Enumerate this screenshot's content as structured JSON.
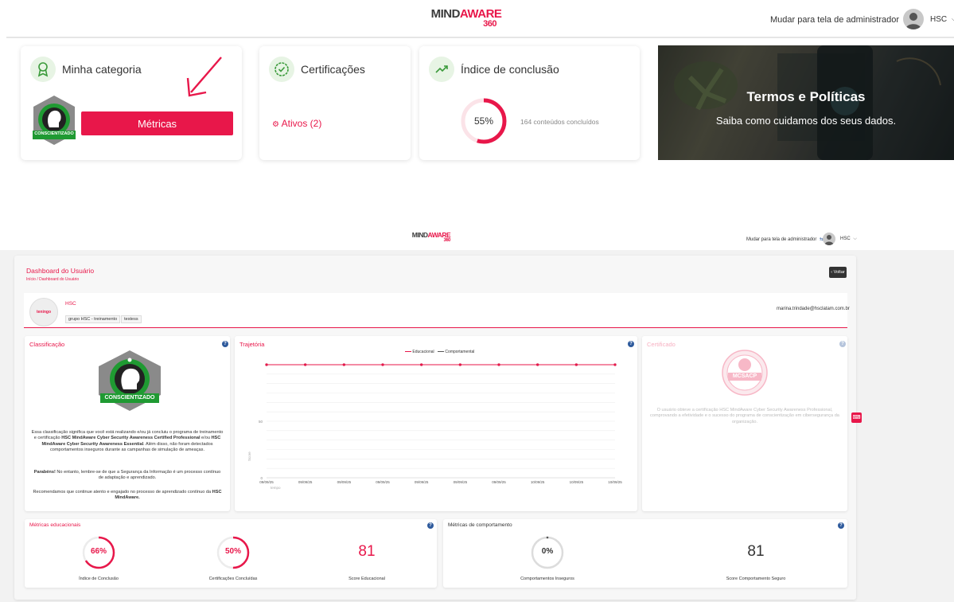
{
  "brand": {
    "name_dark": "MIND",
    "name_accent": "AWARE",
    "version": "360",
    "accent_color": "#e8174a"
  },
  "header": {
    "admin_switch": "Mudar para tela de administrador",
    "user": "HSC"
  },
  "cards": {
    "categoria": {
      "title": "Minha categoria",
      "badge_text": "CONSCIENTIZADO",
      "button": "Métricas"
    },
    "certificacoes": {
      "title": "Certificações",
      "ativos": "Ativos (2)"
    },
    "conclusao": {
      "title": "Índice de conclusão",
      "percent_label": "55%",
      "percent": 55,
      "detail": "164 conteúdos concluídos"
    },
    "termos": {
      "title": "Termos e Políticas",
      "subtitle": "Saiba como cuidamos dos seus dados."
    }
  },
  "dashboard": {
    "header": {
      "admin_switch": "Mudar para tela de administrador",
      "user": "HSC"
    },
    "title": "Dashboard do Usuário",
    "breadcrumb": "Início / Dashboard do Usuário",
    "back_button": "Voltar",
    "profile": {
      "avatar_text": "teningo",
      "name": "HSC",
      "groups": [
        "grupo HSC - treinamento",
        "testess"
      ],
      "email": "marina.trindade@hsclatam.com.br"
    },
    "classificacao": {
      "title": "Classificação",
      "badge_text": "CONSCIENTIZADO",
      "p1_a": "Essa classificação significa que você está realizando e/ou já concluiu o programa de treinamento e certificação ",
      "p1_b": "HSC MindAware Cyber Security Awareness Certified Professional",
      "p1_c": " e/ou ",
      "p1_d": "HSC MindAware Cyber Security Awareness Essential",
      "p1_e": ". Além disso, não foram detectados comportamentos inseguros durante as campanhas de simulação de ameaças.",
      "p2_a": "Parabéns!",
      "p2_b": " No entanto, lembre-se de que a Segurança da Informação é um processo contínuo de adaptação e aprendizado.",
      "p3_a": "Recomendamos que continue atento e engajado no processo de aprendizado contínuo da ",
      "p3_b": "HSC MindAware."
    },
    "trajetoria": {
      "title": "Trajetória",
      "legend": [
        "Educacional",
        "Comportamental"
      ]
    },
    "certificado": {
      "title": "Certificado",
      "seal": "MCSACP",
      "text": "O usuário obteve a certificação HSC MindAware Cyber Security Awareness Professional, comprovando a efetividade e o sucesso do programa de conscientização em cibersegurança da organização."
    },
    "metricas_educacionais": {
      "title": "Métricas educacionais",
      "items": [
        {
          "value": "66%",
          "label": "Índice de Conclusão",
          "percent": 66
        },
        {
          "value": "50%",
          "label": "Certificações Concluídas",
          "percent": 50
        },
        {
          "value": "81",
          "label": "Score Educacional"
        }
      ]
    },
    "metricas_comportamento": {
      "title": "Métricas de comportamento",
      "items": [
        {
          "value": "0%",
          "label": "Comportamentos Inseguros",
          "percent": 0
        },
        {
          "value": "81",
          "label": "Score Comportamento Seguro"
        }
      ]
    }
  },
  "chart_data": {
    "type": "line",
    "x": [
      "09/09/25",
      "09/09/25",
      "09/09/25",
      "09/09/25",
      "09/09/25",
      "09/09/25",
      "09/09/25",
      "10/09/25",
      "10/09/25",
      "10/09/25"
    ],
    "series": [
      {
        "name": "Educacional",
        "values": [
          100,
          100,
          100,
          100,
          100,
          100,
          100,
          100,
          100,
          100
        ],
        "color": "#e8174a"
      },
      {
        "name": "Comportamental",
        "values": [
          100,
          100,
          100,
          100,
          100,
          100,
          100,
          100,
          100,
          100
        ],
        "color": "#555555"
      }
    ],
    "ylim": [
      0,
      100
    ],
    "yticks": [
      "0",
      "50"
    ],
    "xlabel": "tempo",
    "ylabel": "Score",
    "grid": true,
    "legend": "top"
  }
}
